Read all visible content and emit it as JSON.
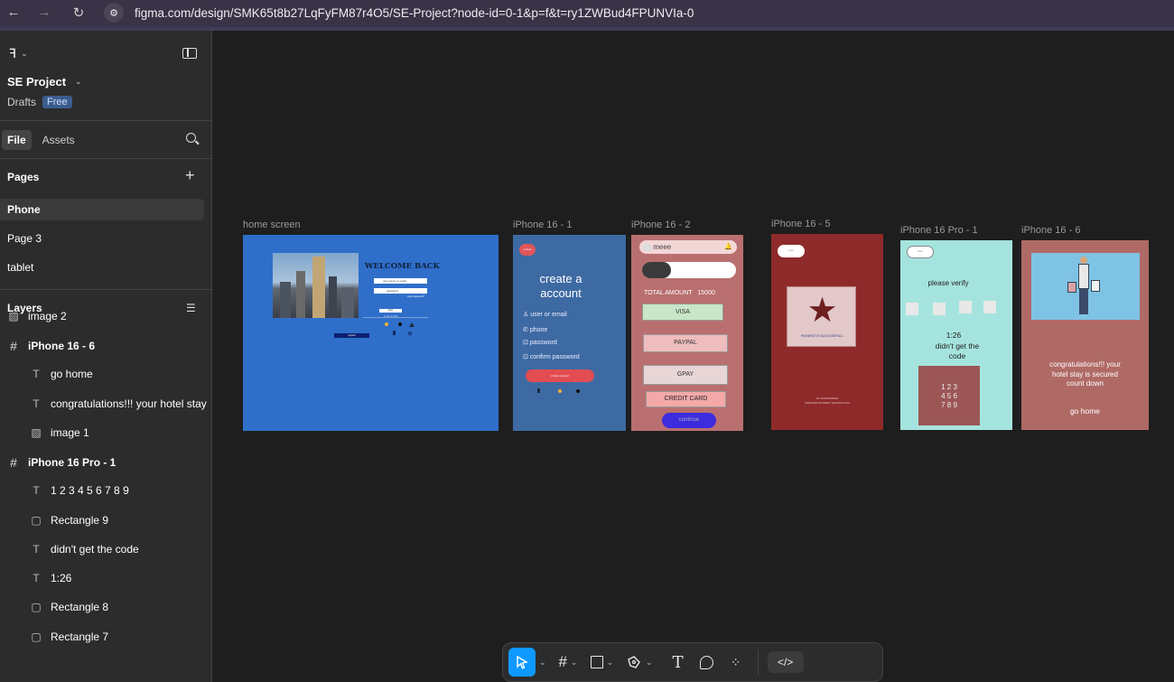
{
  "browser": {
    "url": "figma.com/design/SMK65t8b27LqFyFM87r4O5/SE-Project?node-id=0-1&p=f&t=ry1ZWBud4FPUNVIa-0"
  },
  "sidebar": {
    "project_name": "SE Project",
    "drafts": "Drafts",
    "plan_badge": "Free",
    "tabs": [
      "File",
      "Assets"
    ],
    "pages_title": "Pages",
    "pages": [
      "Phone",
      "Page 3",
      "tablet"
    ],
    "layers_title": "Layers",
    "layers": [
      {
        "label": "image 2",
        "icon": "image-icon",
        "indent": 0,
        "bold": false
      },
      {
        "label": "iPhone 16 - 6",
        "icon": "frame-icon",
        "indent": 0,
        "bold": true
      },
      {
        "label": "go home",
        "icon": "text-icon",
        "indent": 1,
        "bold": false
      },
      {
        "label": "congratulations!!! your hotel stay",
        "icon": "text-icon",
        "indent": 1,
        "bold": false
      },
      {
        "label": "image 1",
        "icon": "image-icon",
        "indent": 1,
        "bold": false
      },
      {
        "label": "iPhone 16 Pro - 1",
        "icon": "frame-icon",
        "indent": 0,
        "bold": true
      },
      {
        "label": "1 2 3 4 5 6 7 8 9",
        "icon": "text-icon",
        "indent": 1,
        "bold": false
      },
      {
        "label": "Rectangle 9",
        "icon": "rectangle-icon",
        "indent": 1,
        "bold": false
      },
      {
        "label": "didn't get the code",
        "icon": "text-icon",
        "indent": 1,
        "bold": false
      },
      {
        "label": "1:26",
        "icon": "text-icon",
        "indent": 1,
        "bold": false
      },
      {
        "label": "Rectangle 8",
        "icon": "rectangle-icon",
        "indent": 1,
        "bold": false
      },
      {
        "label": "Rectangle 7",
        "icon": "rectangle-icon",
        "indent": 1,
        "bold": false
      }
    ]
  },
  "frames": {
    "home": {
      "label": "home screen",
      "welcome": "WELCOME BACK",
      "field1": "user name or email",
      "field2": "password",
      "forgot": "forgot password?",
      "login": "login",
      "or": "or sign in with",
      "register": "register"
    },
    "f1": {
      "label": "iPhone 16 - 1",
      "top_btn": "continue",
      "title": "create a account",
      "fields": [
        "user or email",
        "phone",
        "password",
        "confirm password"
      ],
      "create_btn": "create account"
    },
    "f2": {
      "label": "iPhone 16 - 2",
      "search": "meee",
      "total_label": "TOTAL AMOUNT",
      "total_value": "15000",
      "options": [
        "VISA",
        "PAYPAL",
        "GPAY",
        "CREDIT CARD"
      ],
      "continue": "continue"
    },
    "f5": {
      "label": "iPhone 16 - 5",
      "back": "back",
      "payment": "PAYMENT IS SUCCESSFULL",
      "footer1": "ID: RGS44568936",
      "footer2": "UPDATED PAYMENT SECOND AGO"
    },
    "pro1": {
      "label": "iPhone 16 Pro - 1",
      "back": "back",
      "verify": "please verify",
      "timer": "1:26",
      "didnt": "didn't get the code",
      "keypad": [
        "1 2 3",
        "4 5 6",
        "7 8 9"
      ]
    },
    "f6": {
      "label": "iPhone 16 - 6",
      "congrats": "congratulations!!! your hotel stay is secured count down",
      "go_home": "go home"
    }
  },
  "colors": {
    "canvas": "#1e1e1e",
    "panel": "#2c2c2c",
    "home_bg": "#2f6fca",
    "f1_bg": "#3e6aa3",
    "f2_bg": "#b96f6f",
    "f5_bg": "#8e2a2a",
    "pro1_bg": "#a5e4de",
    "f6_bg": "#b06a66",
    "accent": "#0d99ff"
  }
}
